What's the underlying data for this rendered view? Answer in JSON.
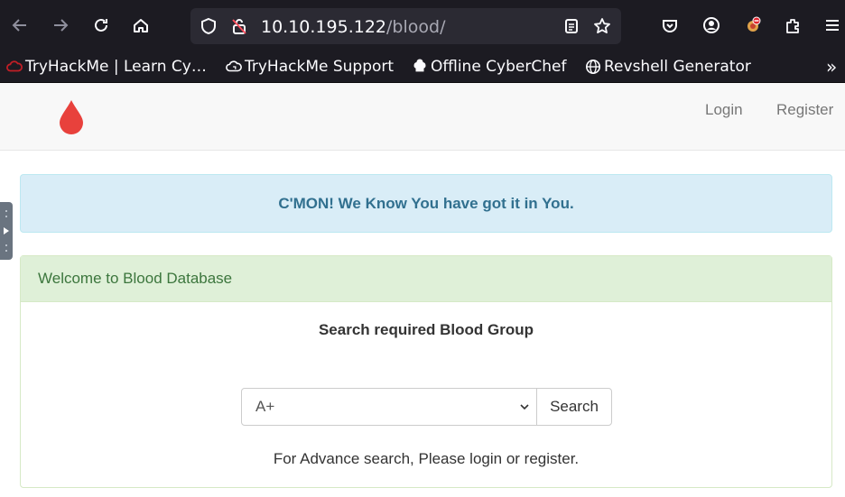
{
  "browser": {
    "url_host": "10.10.195.122",
    "url_path": "/blood/",
    "icons": [
      "back-icon",
      "forward-icon",
      "reload-icon",
      "home-icon",
      "shield-icon",
      "insecure-lock-icon",
      "reader-icon",
      "star-icon",
      "pocket-icon",
      "account-icon",
      "extension-icon",
      "extensions-icon",
      "menu-icon"
    ],
    "bookmarks": [
      {
        "label": "TryHackMe | Learn Cy…"
      },
      {
        "label": "TryHackMe Support"
      },
      {
        "label": "Offline CyberChef"
      },
      {
        "label": "Revshell Generator"
      }
    ],
    "overflow": "»"
  },
  "navbar": {
    "login": "Login",
    "register": "Register",
    "brand_color": "#e8413c"
  },
  "alert": {
    "text": "C'MON! We Know You have got it in You."
  },
  "panel": {
    "heading": "Welcome to Blood Database",
    "title": "Search required Blood Group",
    "select_value": "A+",
    "search_button": "Search",
    "footer_text": "For Advance search, Please login or register."
  }
}
